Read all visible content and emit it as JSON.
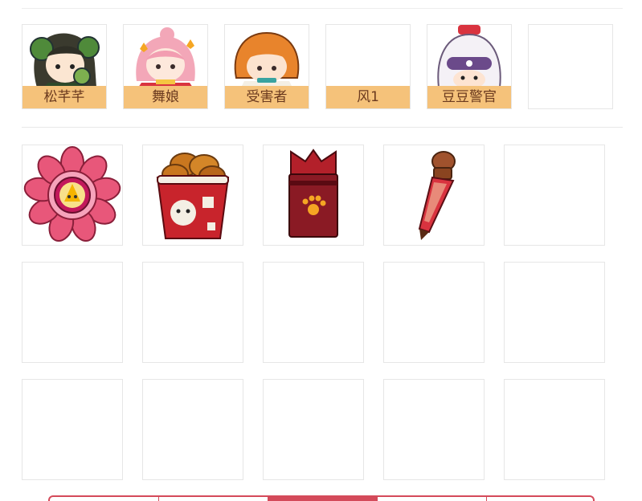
{
  "characters": [
    {
      "name": "松芊芊",
      "icon": "character-pine-girl-icon"
    },
    {
      "name": "舞娘",
      "icon": "character-dancer-icon"
    },
    {
      "name": "受害者",
      "icon": "character-victim-icon"
    },
    {
      "name": "风1",
      "icon": ""
    },
    {
      "name": "豆豆警官",
      "icon": "character-officer-icon"
    }
  ],
  "items": [
    {
      "icon": "pink-flower-badge-icon"
    },
    {
      "icon": "fried-chicken-bucket-icon"
    },
    {
      "icon": "red-paw-box-icon"
    },
    {
      "icon": "red-potion-dropper-icon"
    }
  ],
  "colors": {
    "label_bg": "#f5c27a",
    "label_text": "#6b3a1f",
    "accent": "#d44a5a"
  }
}
